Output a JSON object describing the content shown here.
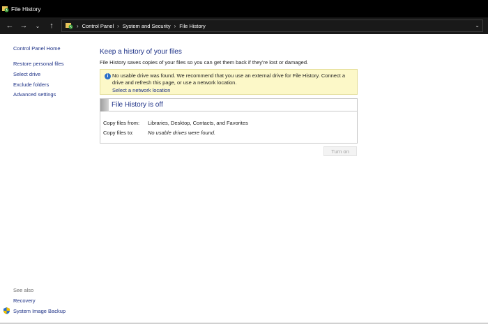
{
  "window": {
    "title": "File History"
  },
  "nav": {
    "back_glyph": "←",
    "forward_glyph": "→",
    "recent_glyph": "⌄",
    "up_glyph": "↑",
    "separator": "›",
    "breadcrumbs": [
      "Control Panel",
      "System and Security",
      "File History"
    ],
    "dropdown_glyph": "⌄"
  },
  "sidebar": {
    "home": "Control Panel Home",
    "items": [
      {
        "label": "Restore personal files"
      },
      {
        "label": "Select drive"
      },
      {
        "label": "Exclude folders"
      },
      {
        "label": "Advanced settings"
      }
    ],
    "see_also": "See also",
    "see_also_items": [
      {
        "label": "Recovery"
      },
      {
        "label": "System Image Backup",
        "icon": "shield-icon"
      }
    ]
  },
  "main": {
    "heading": "Keep a history of your files",
    "description": "File History saves copies of your files so you can get them back if they're lost or damaged.",
    "info": {
      "icon": "info-icon",
      "text": "No usable drive was found. We recommend that you use an external drive for File History. Connect a drive and refresh this page, or use a network location.",
      "link": "Select a network location"
    },
    "status": {
      "title": "File History is off",
      "copy_from_label": "Copy files from:",
      "copy_from_value": "Libraries, Desktop, Contacts, and Favorites",
      "copy_to_label": "Copy files to:",
      "copy_to_value": "No usable drives were found."
    },
    "turn_on_label": "Turn on"
  },
  "colors": {
    "link": "#1e3287",
    "titlebar": "#000000",
    "navbar": "#191919",
    "infobar": "#fcf8c8"
  }
}
